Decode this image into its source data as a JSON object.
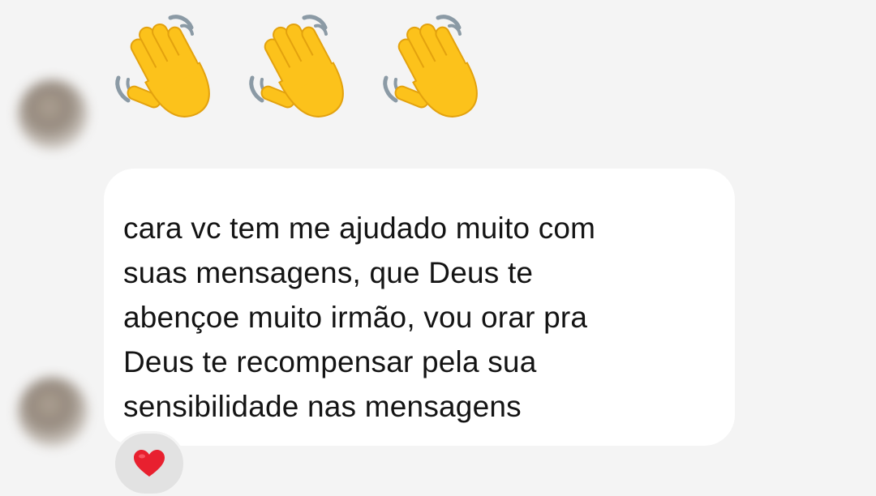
{
  "conversation": {
    "messages": [
      {
        "type": "emoji",
        "icons": [
          "waving-hand-icon",
          "waving-hand-icon",
          "waving-hand-icon"
        ]
      },
      {
        "type": "text",
        "text": "cara vc tem me ajudado muito com\nsuas mensagens, que Deus te\nabençoe muito irmão, vou orar pra\nDeus te recompensar pela sua\nsensibilidade nas mensagens"
      }
    ],
    "reaction": {
      "icon": "red-heart-icon"
    }
  },
  "colors": {
    "background": "#f4f4f4",
    "bubble": "#ffffff",
    "reaction_bg": "#e2e2e2",
    "heart": "#e8202f",
    "emoji_yellow": "#fcc21b"
  }
}
